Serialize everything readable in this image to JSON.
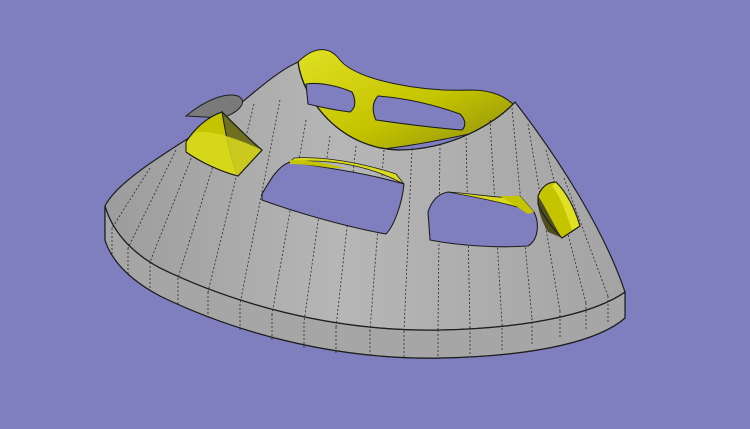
{
  "viewport": {
    "background_color": "#7f7fc0"
  },
  "model": {
    "shell_outer_color": "#aeaeae",
    "shell_top_color": "#b8b8b8",
    "base_band_color": "#a8a8a8",
    "inner_surface_color": "#c4c400",
    "inner_surface_highlight": "#e0e024",
    "inner_surface_shadow": "#70701c",
    "edge_color": "#1e1e1e",
    "seam_color": "#2a2a2a",
    "window_count": 6
  }
}
